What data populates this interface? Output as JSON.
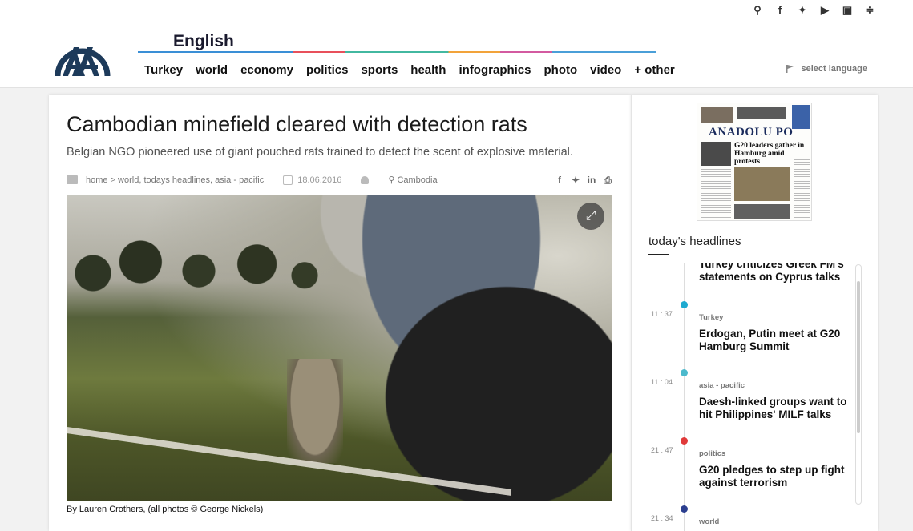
{
  "header": {
    "edition": "English",
    "nav": [
      "Turkey",
      "world",
      "economy",
      "politics",
      "sports",
      "health",
      "infographics",
      "photo",
      "video",
      "+ other"
    ],
    "select_language": "select language",
    "social_icons": [
      "search-icon",
      "facebook-icon",
      "twitter-icon",
      "youtube-icon",
      "instagram-icon",
      "rss-icon"
    ],
    "logo_text": "AA"
  },
  "article": {
    "title": "Cambodian minefield cleared with detection rats",
    "subtitle": "Belgian NGO pioneered use of giant pouched rats trained to detect the scent of explosive material.",
    "breadcrumb": "home > world, todays headlines, asia - pacific",
    "date": "18.06.2016",
    "location": "Cambodia",
    "caption": "By Lauren Crothers, (all photos © George Nickels)",
    "share_icons": [
      "facebook-share-icon",
      "twitter-share-icon",
      "linkedin-share-icon",
      "print-icon"
    ]
  },
  "sidebar": {
    "paper": {
      "masthead": "ANADOLU PO",
      "headline": "G20 leaders gather in Hamburg amid protests"
    },
    "headlines_title": "today's headlines",
    "items": [
      {
        "time": "",
        "category": "",
        "title": "Turkey criticizes Greek FM's statements on Cyprus talks",
        "color": ""
      },
      {
        "time": "11 : 37",
        "category": "Turkey",
        "title": "Erdogan, Putin meet at G20 Hamburg Summit",
        "color": "#1eaad0"
      },
      {
        "time": "11 : 04",
        "category": "asia - pacific",
        "title": "Daesh-linked groups want to hit Philippines' MILF talks",
        "color": "#4bb9cc"
      },
      {
        "time": "21 : 47",
        "category": "politics",
        "title": "G20 pledges to step up fight against terrorism",
        "color": "#e03a3a"
      },
      {
        "time": "21 : 34",
        "category": "world",
        "title": "",
        "color": "#2b3e8f"
      }
    ]
  }
}
